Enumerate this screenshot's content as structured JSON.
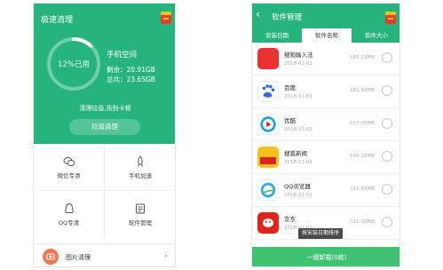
{
  "left": {
    "title": "极速清理",
    "storage": {
      "used_text": "12%已用",
      "used_fraction": 0.12,
      "name": "手机空间",
      "remaining_label": "剩余：",
      "remaining_value": "20.91GB",
      "total_label": "总共：",
      "total_value": "23.65GB"
    },
    "slogan": "清理垃圾,告别卡顿",
    "clean_button": "垃圾清理",
    "tools": [
      {
        "label": "微信专清",
        "icon": "wechat-icon"
      },
      {
        "label": "手机加速",
        "icon": "rocket-icon"
      },
      {
        "label": "QQ专清",
        "icon": "qq-penguin-icon"
      },
      {
        "label": "软件管理",
        "icon": "app-manage-icon"
      }
    ],
    "photo_row": {
      "label": "图片清理",
      "icon": "photo-icon",
      "chevron": "›"
    }
  },
  "right": {
    "back": "‹",
    "title": "软件管理",
    "tabs": [
      {
        "label": "安装日期",
        "active": false
      },
      {
        "label": "软件名称",
        "active": true
      },
      {
        "label": "软件大小",
        "active": false
      }
    ],
    "apps": [
      {
        "name": "搜狗输入法",
        "date": "2018-01-02",
        "size": "185.13MB",
        "icon": "sogou-input-icon",
        "color": "#e8322f"
      },
      {
        "name": "百度",
        "date": "2018-01-02",
        "size": "181.96MB",
        "icon": "baidu-icon",
        "color": "#2e6ddf"
      },
      {
        "name": "优酷",
        "date": "2018-01-02",
        "size": "157.05MB",
        "icon": "youku-icon",
        "color": "#1e9ff2"
      },
      {
        "name": "搜狐新闻",
        "date": "2018-01-02",
        "size": "145.16MB",
        "icon": "sohu-news-icon",
        "color": "#f5c21b"
      },
      {
        "name": "QQ浏览器",
        "date": "2018-01-02",
        "size": "115.65MB",
        "icon": "qq-browser-icon",
        "color": "#2aa6f2"
      },
      {
        "name": "京东",
        "date": "2018-01-02",
        "size": "111.39MB",
        "icon": "jd-icon",
        "color": "#e2231a"
      }
    ],
    "sort_tooltip": "按安装日期排序",
    "uninstall_button": "一键卸载(0款)"
  },
  "colors": {
    "brand_green": "#26b47c",
    "button_green": "#3fc372"
  }
}
